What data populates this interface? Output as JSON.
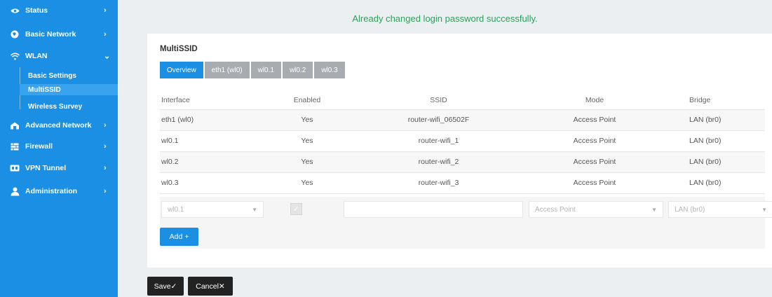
{
  "sidebar": {
    "items": [
      {
        "label": "Status",
        "icon": "eye-icon",
        "chevron": "›"
      },
      {
        "label": "Basic Network",
        "icon": "globe-icon",
        "chevron": "›"
      },
      {
        "label": "WLAN",
        "icon": "wifi-icon",
        "chevron": "⌄"
      },
      {
        "label": "Advanced Network",
        "icon": "network-icon",
        "chevron": "›"
      },
      {
        "label": "Firewall",
        "icon": "firewall-icon",
        "chevron": "›"
      },
      {
        "label": "VPN Tunnel",
        "icon": "vpn-icon",
        "chevron": "›"
      },
      {
        "label": "Administration",
        "icon": "admin-icon",
        "chevron": "›"
      }
    ],
    "wlan_subitems": [
      {
        "label": "Basic Settings"
      },
      {
        "label": "MultiSSID",
        "active": true
      },
      {
        "label": "Wireless Survey"
      }
    ]
  },
  "banner": {
    "message": "Already changed login password successfully."
  },
  "panel": {
    "title": "MultiSSID",
    "tabs": [
      "Overview",
      "eth1 (wl0)",
      "wl0.1",
      "wl0.2",
      "wl0.3"
    ],
    "columns": [
      "Interface",
      "Enabled",
      "SSID",
      "Mode",
      "Bridge"
    ],
    "rows": [
      [
        "eth1 (wl0)",
        "Yes",
        "router-wifi_06502F",
        "Access Point",
        "LAN (br0)"
      ],
      [
        "wl0.1",
        "Yes",
        "router-wifi_1",
        "Access Point",
        "LAN (br0)"
      ],
      [
        "wl0.2",
        "Yes",
        "router-wifi_2",
        "Access Point",
        "LAN (br0)"
      ],
      [
        "wl0.3",
        "Yes",
        "router-wifi_3",
        "Access Point",
        "LAN (br0)"
      ]
    ],
    "edit": {
      "interface_value": "wl0.1",
      "enabled_mark": "✓",
      "ssid_value": "",
      "mode_value": "Access Point",
      "bridge_value": "LAN (br0)",
      "arrow": "▼",
      "add_label": "Add +"
    }
  },
  "footer": {
    "save_label": "Save✓",
    "cancel_label": "Cancel✕"
  },
  "colors": {
    "accent": "#1a8fe3",
    "success": "#2e9e5a",
    "tab_inactive": "#a8acb1",
    "footer_button": "#222222"
  }
}
